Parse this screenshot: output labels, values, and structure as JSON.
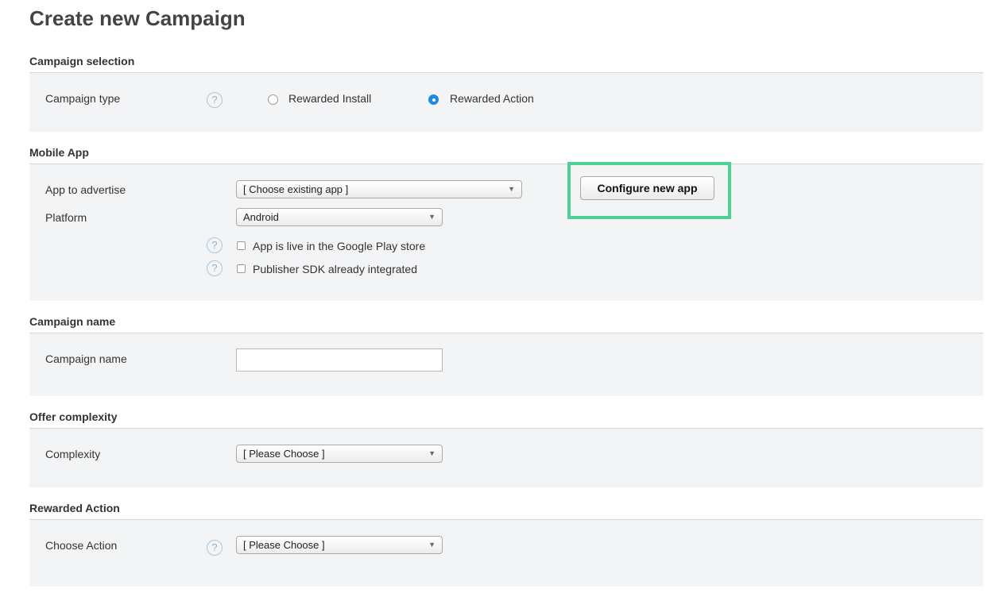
{
  "page": {
    "title": "Create new Campaign"
  },
  "sections": {
    "campaign_selection": {
      "title": "Campaign selection",
      "campaign_type_label": "Campaign type",
      "options": [
        {
          "label": "Rewarded Install",
          "selected": false
        },
        {
          "label": "Rewarded Action",
          "selected": true
        }
      ]
    },
    "mobile_app": {
      "title": "Mobile App",
      "app_label": "App to advertise",
      "app_select_value": "[ Choose existing app ]",
      "configure_button": "Configure new app",
      "platform_label": "Platform",
      "platform_value": "Android",
      "checkbox_live": "App is live in the Google Play store",
      "checkbox_sdk": "Publisher SDK already integrated"
    },
    "campaign_name": {
      "title": "Campaign name",
      "name_label": "Campaign name",
      "name_value": ""
    },
    "offer_complexity": {
      "title": "Offer complexity",
      "complexity_label": "Complexity",
      "complexity_value": "[ Please Choose ]"
    },
    "rewarded_action": {
      "title": "Rewarded Action",
      "action_label": "Choose Action",
      "action_value": "[ Please Choose ]"
    }
  },
  "icons": {
    "help": "?",
    "caret": "▼"
  },
  "colors": {
    "highlight": "#4dd197",
    "radio_selected": "#1e88e5",
    "panel_bg": "#f3f4f6"
  }
}
